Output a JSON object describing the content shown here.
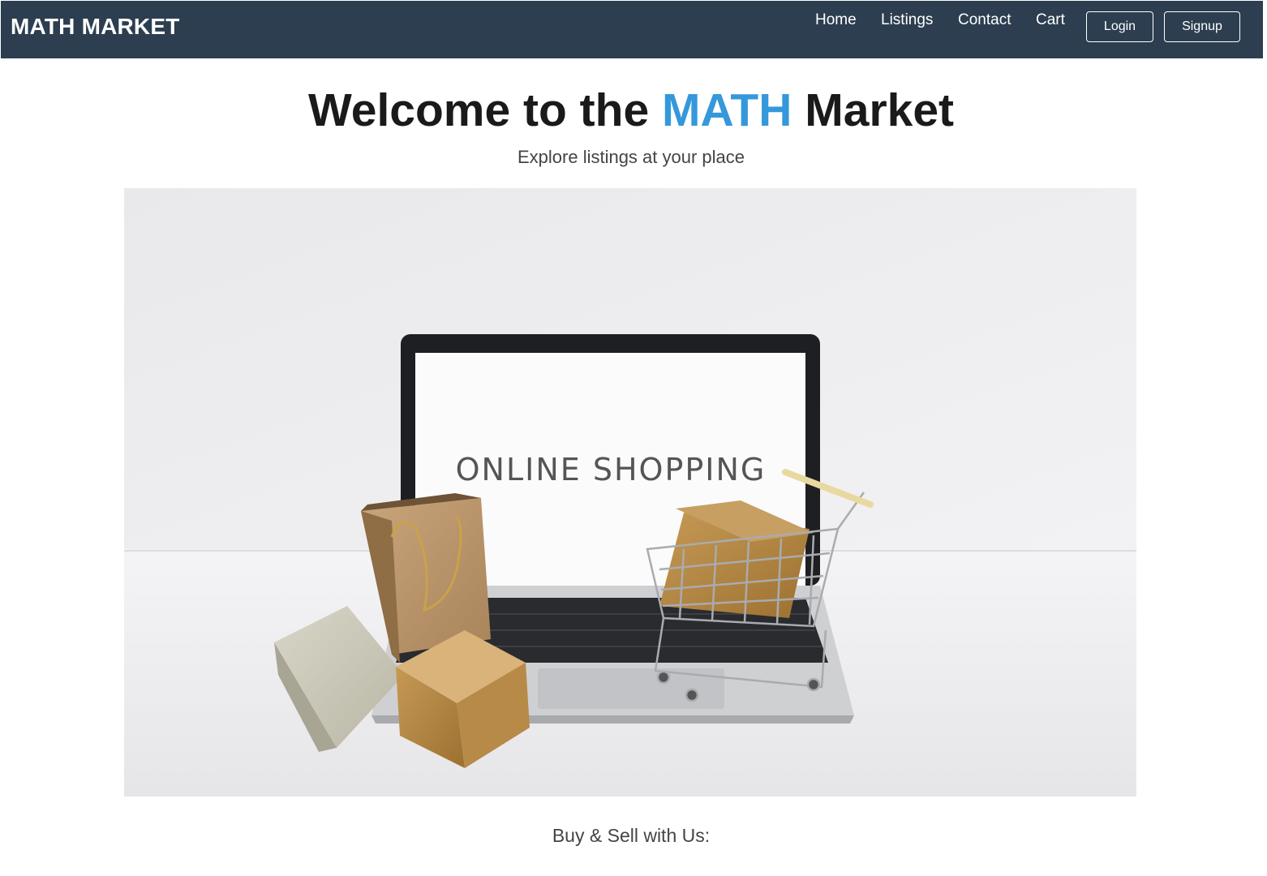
{
  "navbar": {
    "brand": "MATH MARKET",
    "links": [
      {
        "label": "Home"
      },
      {
        "label": "Listings"
      },
      {
        "label": "Contact"
      },
      {
        "label": "Cart"
      }
    ],
    "login_label": "Login",
    "signup_label": "Signup",
    "background_color": "#2c3e50"
  },
  "hero": {
    "title_prefix": "Welcome to the ",
    "title_accent": "MATH",
    "title_suffix": " Market",
    "subtitle": "Explore listings at your place",
    "accent_color": "#3498db",
    "image": {
      "screen_text": "ONLINE SHOPPING"
    }
  },
  "section": {
    "heading": "Buy & Sell with Us:"
  }
}
